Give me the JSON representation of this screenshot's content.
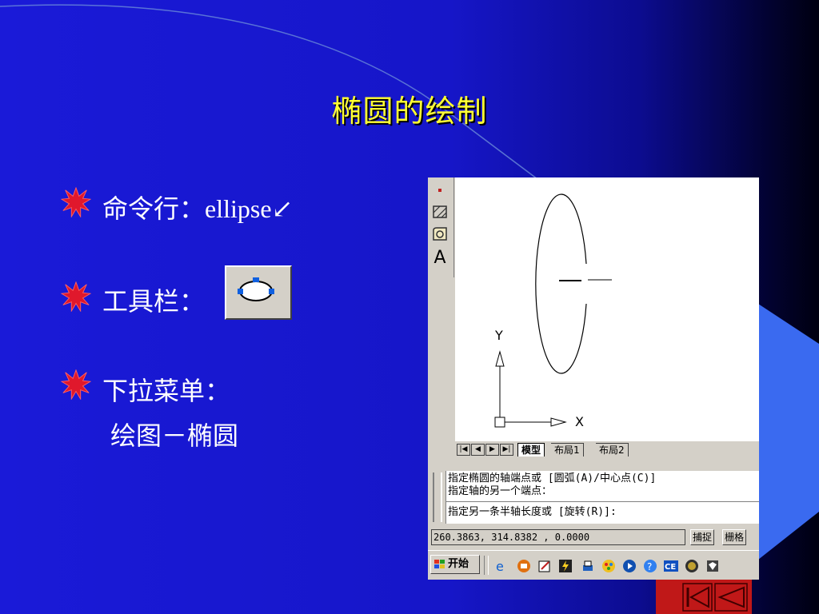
{
  "slide": {
    "title": "椭圆的绘制",
    "bullets": [
      {
        "label": "命令行：",
        "value": "ellipse",
        "enter_symbol": "↙"
      },
      {
        "label": "工具栏："
      },
      {
        "label": "下拉菜单：",
        "sub": "绘图－椭圆"
      }
    ],
    "colors": {
      "title": "#ffff33",
      "text": "#ffffff",
      "star": "#e0182c",
      "background": "#1616c8"
    }
  },
  "toolbar_button": {
    "icon": "ellipse-tool-icon"
  },
  "cad_window": {
    "sidebar_icons": [
      "point-icon",
      "hatch-icon",
      "region-icon",
      "text-icon"
    ],
    "sidebar_text_icon_label": "A",
    "ucs": {
      "y_label": "Y",
      "x_label": "X"
    },
    "tabs": {
      "nav_buttons": [
        "|◀",
        "◀",
        "▶",
        "▶|"
      ],
      "items": [
        "模型",
        "布局1",
        "布局2"
      ],
      "active": "模型"
    },
    "command_lines": [
      "指定椭圆的轴端点或 [圆弧(A)/中心点(C)]",
      "指定轴的另一个端点：",
      "指定另一条半轴长度或 [旋转(R)]:"
    ],
    "status": {
      "coords": "260.3863,  314.8382 , 0.0000",
      "buttons": [
        "捕捉",
        "栅格"
      ]
    },
    "taskbar": {
      "start_label": "开始",
      "tray_icons": [
        "ie-icon",
        "app-icon",
        "edit-icon",
        "flash-icon",
        "printer-icon",
        "paint-icon",
        "media-icon",
        "help-icon",
        "ce-icon",
        "globe-icon",
        "shield-icon"
      ],
      "ce_label": "CE"
    }
  }
}
